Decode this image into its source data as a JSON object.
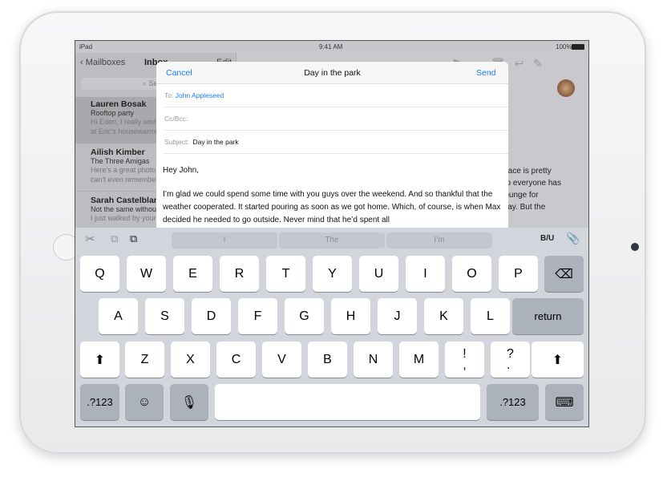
{
  "status": {
    "device": "iPad",
    "time": "9:41 AM",
    "battery": "100%"
  },
  "mailbox": {
    "back": "Mailboxes",
    "title": "Inbox",
    "edit": "Edit",
    "search_placeholder": "Search",
    "items": [
      {
        "name": "Lauren Bosak",
        "subject": "Rooftop party",
        "preview1": "Hi Eden, I really wish",
        "preview2": "at Eric's housewarming"
      },
      {
        "name": "Ailish Kimber",
        "subject": "The Three Amigas",
        "preview1": "Here's a great photo",
        "preview2": "can't even remember"
      },
      {
        "name": "Sarah Castelblanco",
        "subject": "Not the same without",
        "preview1": "I just walked by your"
      }
    ]
  },
  "detail": {
    "lines": [
      "place is pretty",
      "up everyone has",
      "rounge for",
      "way. But the"
    ]
  },
  "compose": {
    "cancel": "Cancel",
    "title": "Day in the park",
    "send": "Send",
    "to_label": "To:",
    "to_value": "John Appleseed",
    "cc_label": "Cc/Bcc:",
    "subject_label": "Subject:",
    "subject_value": "Day in the park",
    "greeting": "Hey John,",
    "body": "I’m glad we could spend some time with you guys over the weekend. And so thankful that the weather cooperated. It started pouring as soon as we got home. Which, of course, is when Max decided he needed to go outside. Never mind that he’d spent all"
  },
  "keyboard": {
    "suggestions": [
      "I",
      "The",
      "I’m"
    ],
    "format": "B/U",
    "row1": [
      "Q",
      "W",
      "E",
      "R",
      "T",
      "Y",
      "U",
      "I",
      "O",
      "P"
    ],
    "row2": [
      "A",
      "S",
      "D",
      "F",
      "G",
      "H",
      "J",
      "K",
      "L"
    ],
    "return": "return",
    "row3": [
      "Z",
      "X",
      "C",
      "V",
      "B",
      "N",
      "M",
      "!\n,",
      "?\n."
    ],
    "numbers": ".?123"
  },
  "colors": {
    "accent": "#1a7cf6"
  }
}
